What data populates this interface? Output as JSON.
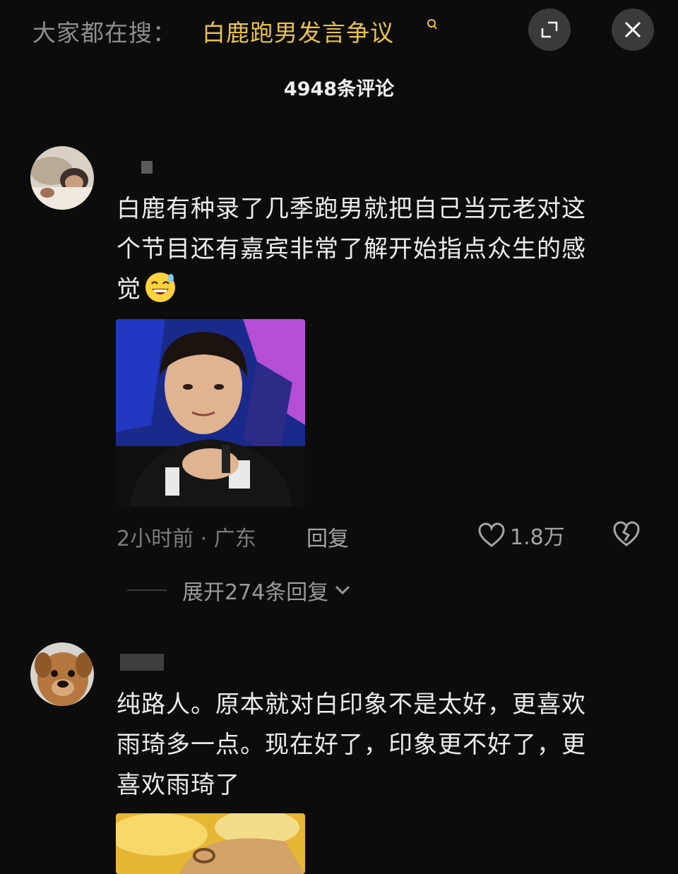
{
  "search": {
    "prefix": "大家都在搜：",
    "term": "白鹿跑男发言争议",
    "icon": "search-icon"
  },
  "header": {
    "comment_count": "4948条评论",
    "minimize_icon": "minimize-icon",
    "close_icon": "close-icon"
  },
  "comments": [
    {
      "text_line1": "白鹿有种录了几季跑男就把自己当元老对这",
      "text_line2": "个节目还有嘉宾非常了解开始指点众生的感",
      "text_line3": "觉",
      "emoji": "grinning-sweat-emoji",
      "time_location": "2小时前 · 广东",
      "reply_label": "回复",
      "likes": "1.8万",
      "expand_label": "展开274条回复"
    },
    {
      "text_line1": "纯路人。原本就对白印象不是太好，更喜欢",
      "text_line2": "雨琦多一点。现在好了，印象更不好了，更",
      "text_line3": "喜欢雨琦了"
    }
  ],
  "colors": {
    "background": "#0c0c0c",
    "search_highlight": "#e8c24a",
    "muted": "#7c7c7c"
  }
}
